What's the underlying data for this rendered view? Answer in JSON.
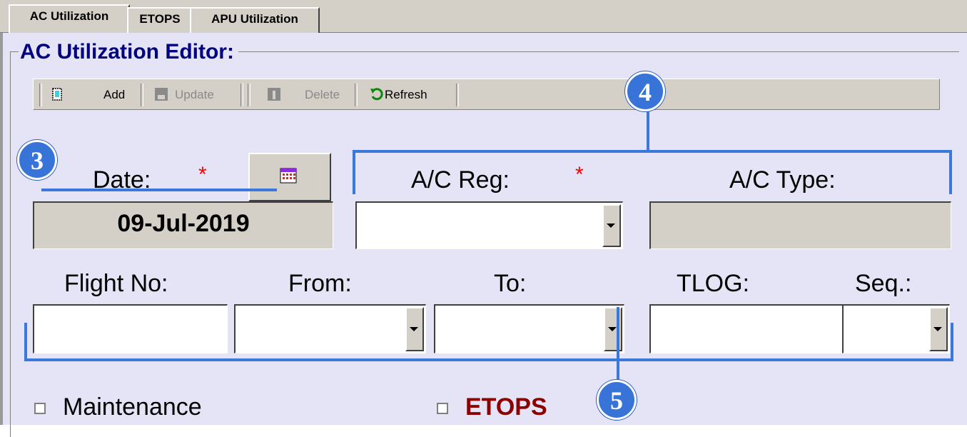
{
  "tabs": [
    {
      "label": "AC Utilization",
      "active": true
    },
    {
      "label": "ETOPS",
      "active": false
    },
    {
      "label": "APU Utilization",
      "active": false
    }
  ],
  "editor": {
    "title": "AC Utilization Editor:"
  },
  "toolbar": {
    "add_label": "Add",
    "update_label": "Update",
    "delete_label": "Delete",
    "refresh_label": "Refresh"
  },
  "form": {
    "date_label": "Date:",
    "date_value": "09-Jul-2019",
    "required_mark": "*",
    "ac_reg_label": "A/C Reg:",
    "ac_reg_value": "",
    "ac_type_label": "A/C Type:",
    "ac_type_value": "",
    "flight_no_label": "Flight No:",
    "from_label": "From:",
    "to_label": "To:",
    "tlog_label": "TLOG:",
    "seq_label": "Seq.:"
  },
  "checkboxes": {
    "maintenance_label": "Maintenance",
    "maintenance_checked": false,
    "etops_label": "ETOPS",
    "etops_checked": false
  },
  "callouts": [
    "3",
    "4",
    "5"
  ],
  "colors": {
    "panel_bg": "#e5e4f7",
    "title_color": "#000080",
    "callout_blue": "#3874d8",
    "required_red": "#ff0000",
    "etops_red": "#8b0000"
  }
}
